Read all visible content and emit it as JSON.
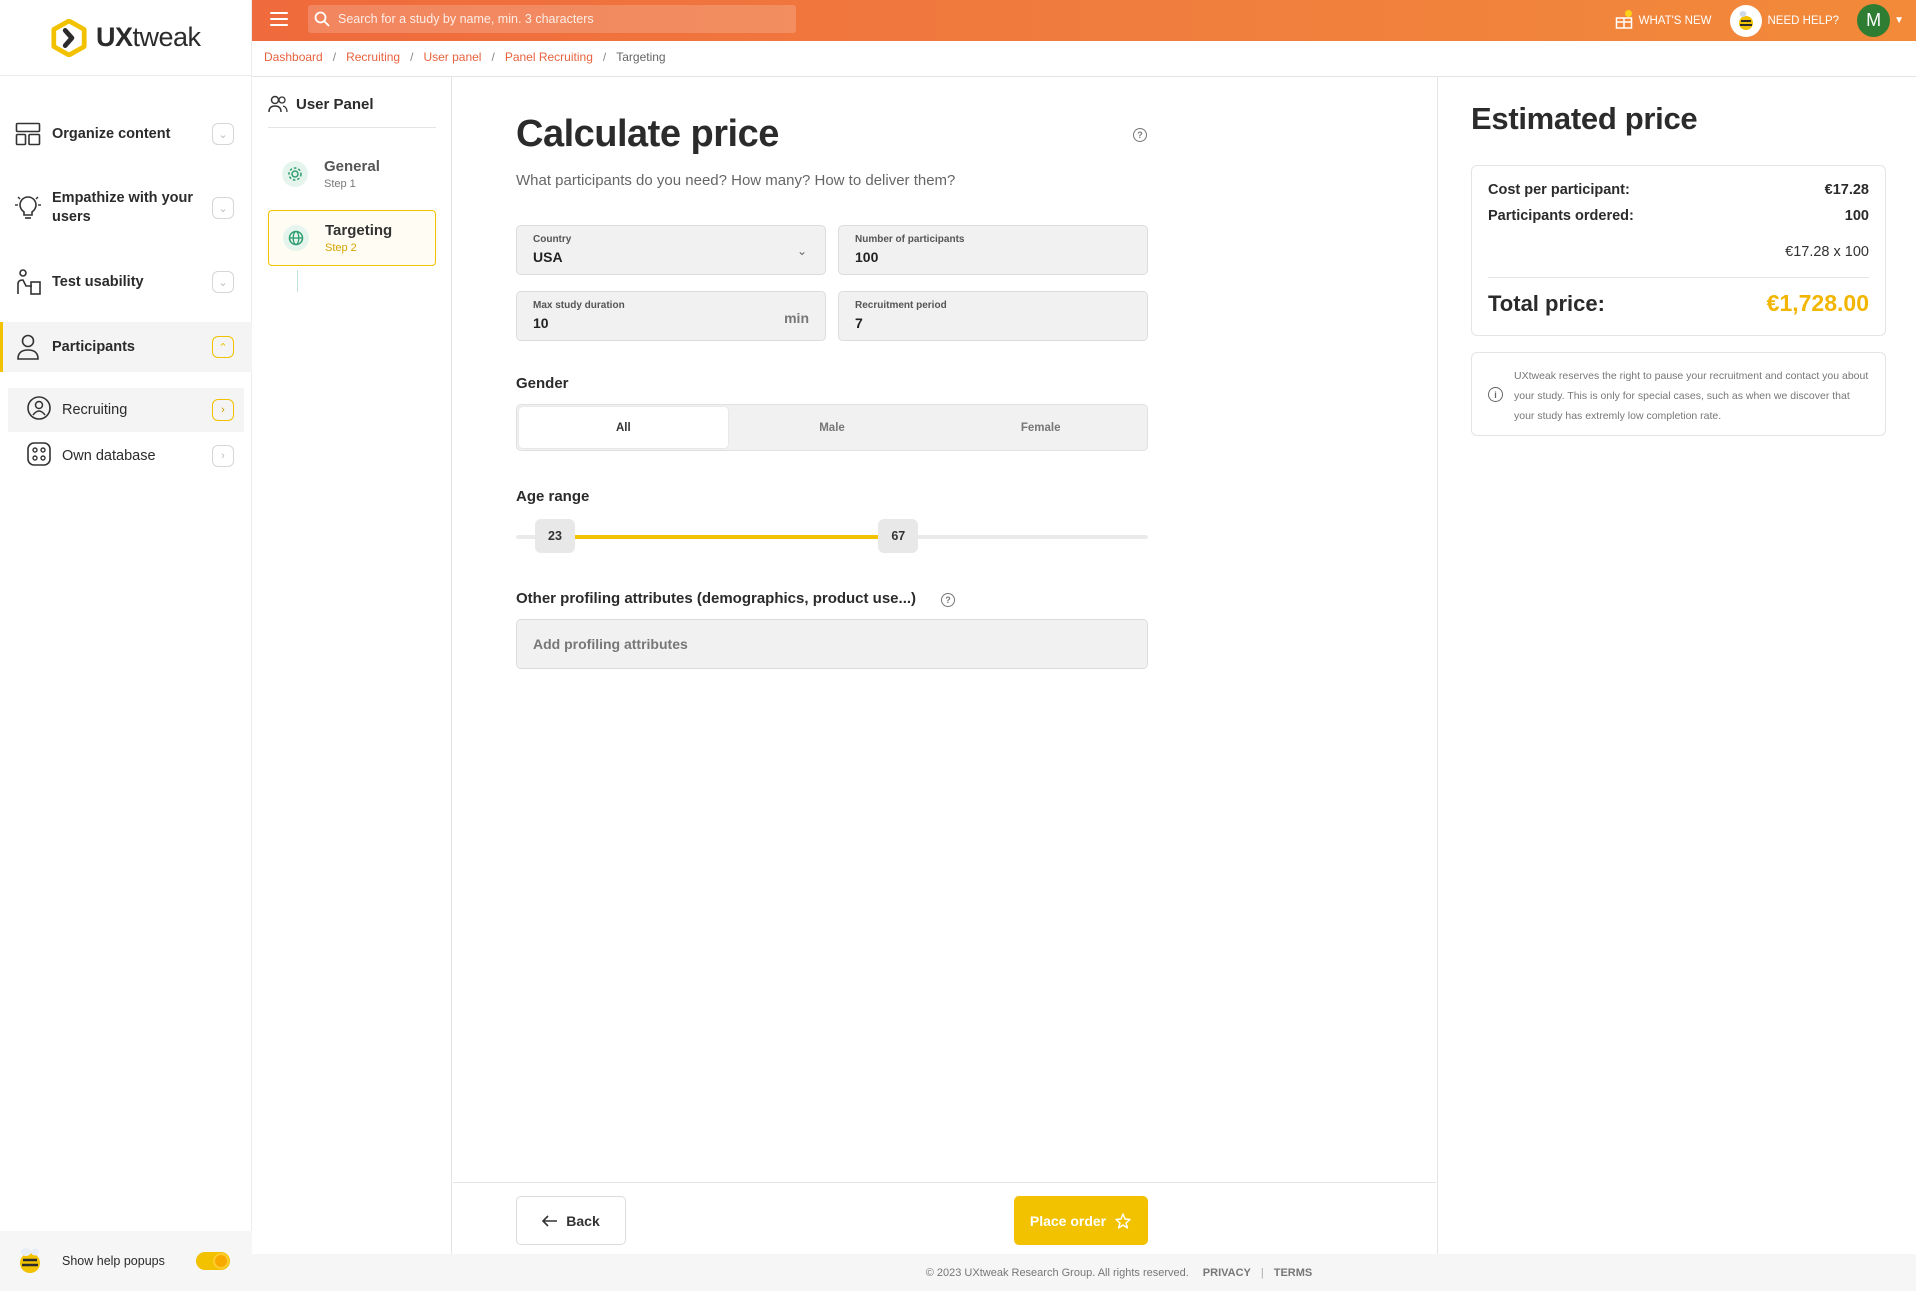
{
  "app": {
    "logo_text_bold": "UX",
    "logo_text_rest": "tweak"
  },
  "topbar": {
    "search_placeholder": "Search for a study by name, min. 3 characters",
    "whats_new": "WHAT'S NEW",
    "need_help": "NEED HELP?",
    "avatar_initial": "M"
  },
  "breadcrumb": [
    "Dashboard",
    "Recruiting",
    "User panel",
    "Panel Recruiting",
    "Targeting"
  ],
  "sidebar": {
    "items": [
      {
        "label": "Organize content",
        "icon": "layout-icon"
      },
      {
        "label": "Empathize with your users",
        "icon": "lightbulb-icon"
      },
      {
        "label": "Test usability",
        "icon": "usability-icon"
      },
      {
        "label": "Participants",
        "icon": "person-icon"
      }
    ],
    "subitems": [
      {
        "label": "Recruiting",
        "icon": "recruiting-icon"
      },
      {
        "label": "Own database",
        "icon": "database-icon"
      }
    ],
    "help_popups_label": "Show help popups",
    "help_popups_on": true
  },
  "steps": {
    "title": "User Panel",
    "items": [
      {
        "name": "General",
        "step": "Step 1"
      },
      {
        "name": "Targeting",
        "step": "Step 2"
      }
    ]
  },
  "form": {
    "title": "Calculate price",
    "subtitle": "What participants do you need? How many? How to deliver them?",
    "country": {
      "label": "Country",
      "value": "USA"
    },
    "participants": {
      "label": "Number of participants",
      "value": "100"
    },
    "duration": {
      "label": "Max study duration",
      "value": "10",
      "suffix": "min"
    },
    "recruitment": {
      "label": "Recruitment period",
      "value": "7"
    },
    "gender": {
      "label": "Gender",
      "options": [
        "All",
        "Male",
        "Female"
      ],
      "selected": "All"
    },
    "age": {
      "label": "Age range",
      "min": 23,
      "max": 67,
      "scale_min": 18,
      "scale_max": 99
    },
    "profiling": {
      "label": "Other profiling attributes (demographics, product use...)",
      "placeholder": "Add profiling attributes"
    },
    "back_label": "Back",
    "order_label": "Place order"
  },
  "estimate": {
    "title": "Estimated price",
    "cost_label": "Cost per participant:",
    "cost_value": "€17.28",
    "ordered_label": "Participants ordered:",
    "ordered_value": "100",
    "formula": "€17.28 x 100",
    "total_label": "Total price:",
    "total_value": "€1,728.00",
    "notice": "UXtweak reserves the right to pause your recruitment and contact you about your study. This is only for special cases, such as when we discover that your study has extremly low completion rate."
  },
  "footer": {
    "copyright": "© 2023 UXtweak Research Group. All rights reserved.",
    "privacy": "PRIVACY",
    "terms": "TERMS"
  },
  "colors": {
    "accent": "#f2c200",
    "topbar": "#ef6a3c",
    "link": "#e8623e"
  }
}
